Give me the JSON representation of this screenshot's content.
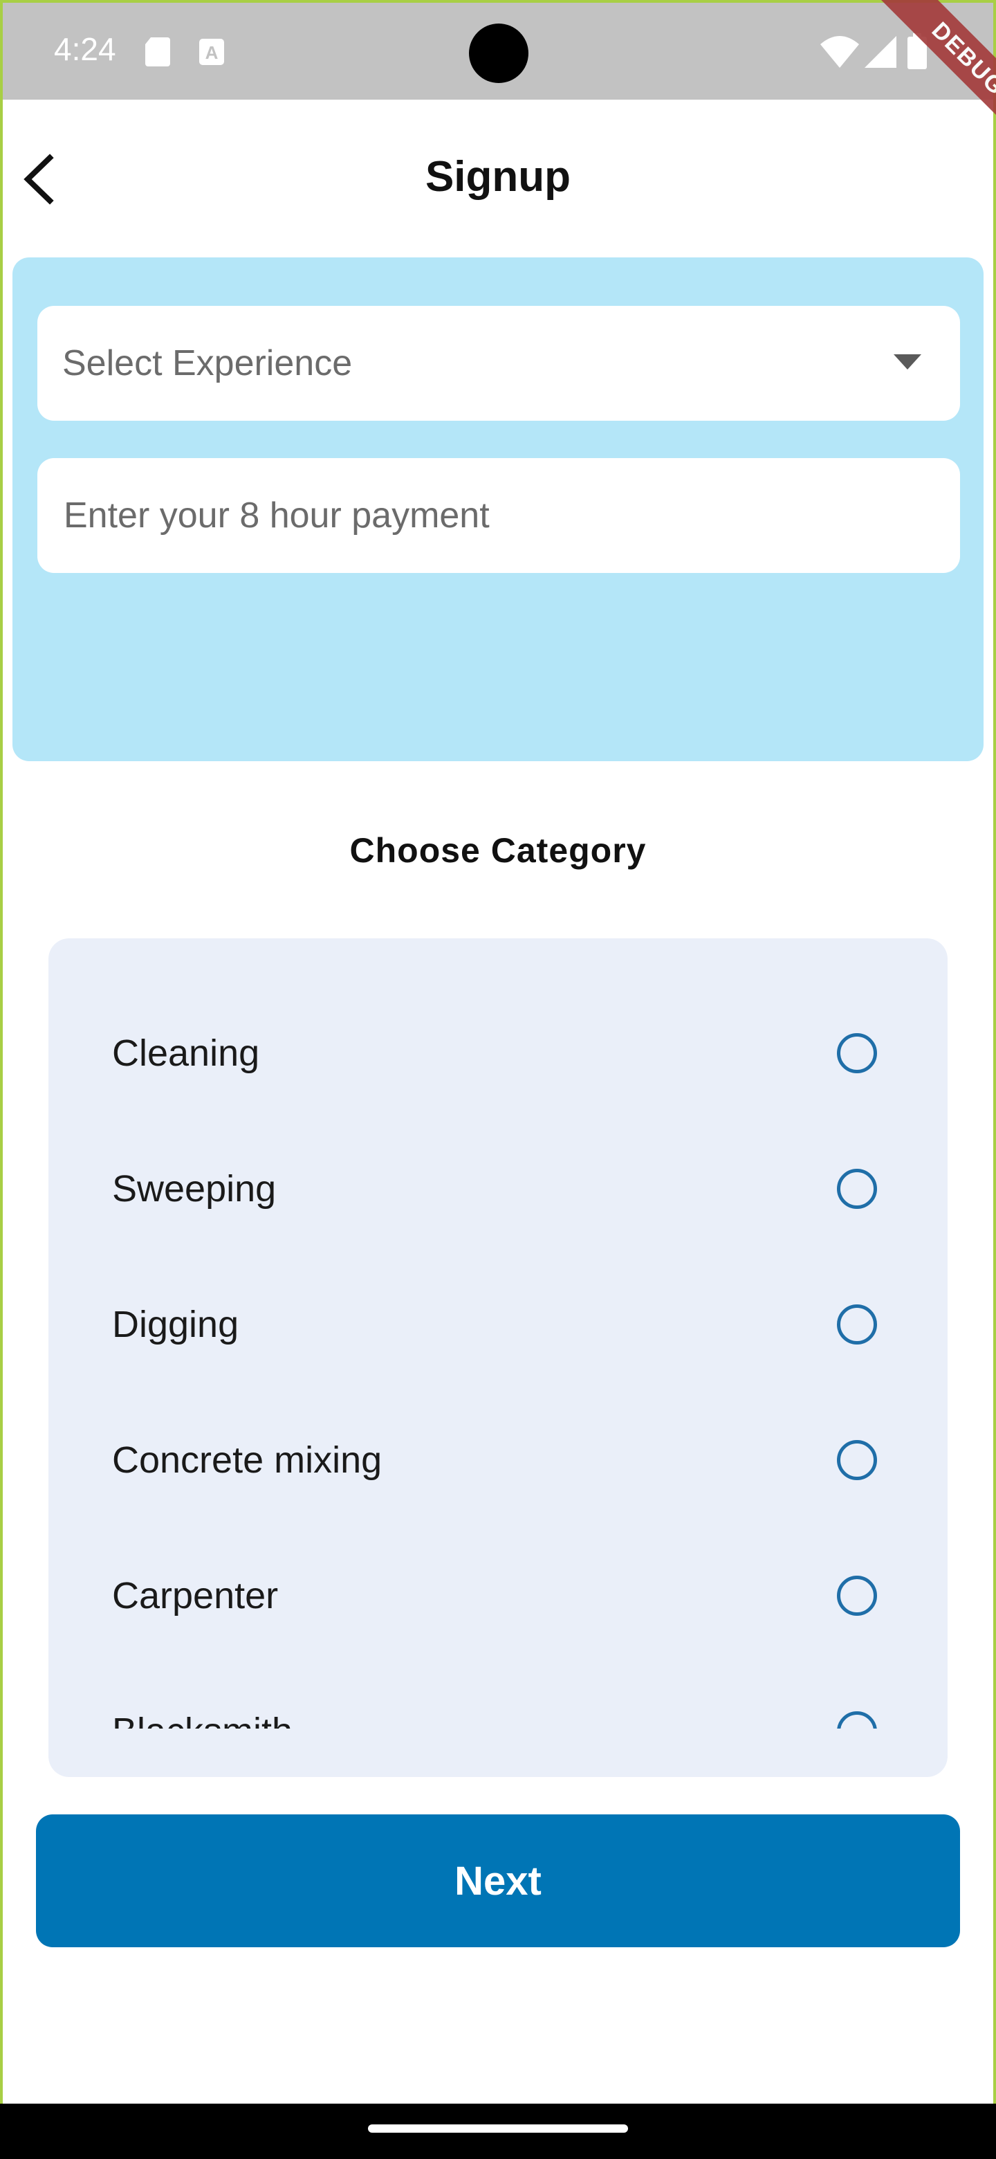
{
  "status_bar": {
    "time": "4:24",
    "icons": [
      "sd-card-icon",
      "font-icon",
      "wifi-icon",
      "signal-icon",
      "battery-icon"
    ],
    "debug_label": "DEBUG"
  },
  "app_bar": {
    "title": "Signup",
    "back_icon": "back-arrow-icon"
  },
  "form": {
    "experience_select": {
      "placeholder": "Select Experience",
      "icon": "dropdown-arrow-icon"
    },
    "payment_input": {
      "placeholder": "Enter your 8 hour payment",
      "value": ""
    }
  },
  "category": {
    "title": "Choose Category",
    "items": [
      {
        "label": "Cleaning",
        "selected": false
      },
      {
        "label": "Sweeping",
        "selected": false
      },
      {
        "label": "Digging",
        "selected": false
      },
      {
        "label": "Concrete mixing",
        "selected": false
      },
      {
        "label": "Carpenter",
        "selected": false
      },
      {
        "label": "Blacksmith",
        "selected": false
      }
    ]
  },
  "next_button": {
    "label": "Next"
  },
  "colors": {
    "card_bg": "#b4e6f8",
    "panel_bg": "#eaeff9",
    "accent": "#0075b5",
    "radio": "#1f6ea8"
  }
}
